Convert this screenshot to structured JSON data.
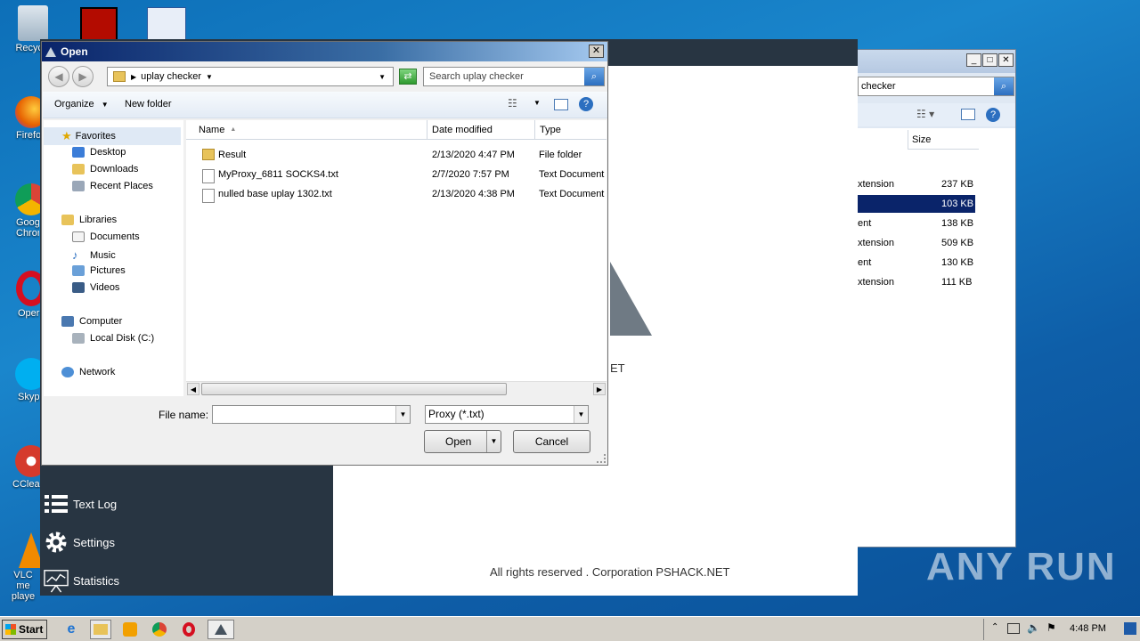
{
  "desktop": {
    "icons": [
      {
        "label": "Recycle"
      },
      {
        "label": "Firefo"
      },
      {
        "label": "Goog Chron"
      },
      {
        "label": "Oper"
      },
      {
        "label": "Skyp"
      },
      {
        "label": "CClea"
      },
      {
        "label": "VLC me playe"
      }
    ]
  },
  "app": {
    "sidebar": [
      "Text Log",
      "Settings",
      "Statistics"
    ],
    "logo_suffix": "ET",
    "footer": "All rights reserved . Corporation PSHACK.NET"
  },
  "explorer": {
    "search_text": "checker",
    "size_header": "Size",
    "rows": [
      {
        "type": "xtension",
        "size": "237 KB"
      },
      {
        "type": "",
        "size": "103 KB"
      },
      {
        "type": "ent",
        "size": "138 KB"
      },
      {
        "type": "xtension",
        "size": "509 KB"
      },
      {
        "type": "ent",
        "size": "130 KB"
      },
      {
        "type": "xtension",
        "size": "111 KB"
      }
    ]
  },
  "dialog": {
    "title": "Open",
    "address": "uplay checker",
    "search_placeholder": "Search uplay checker",
    "organize": "Organize",
    "new_folder": "New folder",
    "nav": {
      "favorites": "Favorites",
      "desktop": "Desktop",
      "downloads": "Downloads",
      "recent": "Recent Places",
      "libraries": "Libraries",
      "documents": "Documents",
      "music": "Music",
      "pictures": "Pictures",
      "videos": "Videos",
      "computer": "Computer",
      "local_disk": "Local Disk (C:)",
      "network": "Network"
    },
    "columns": {
      "name": "Name",
      "date": "Date modified",
      "type": "Type"
    },
    "files": [
      {
        "name": "Result",
        "date": "2/13/2020 4:47 PM",
        "type": "File folder"
      },
      {
        "name": "MyProxy_6811 SOCKS4.txt",
        "date": "2/7/2020 7:57 PM",
        "type": "Text Document"
      },
      {
        "name": "nulled base uplay 1302.txt",
        "date": "2/13/2020 4:38 PM",
        "type": "Text Document"
      }
    ],
    "file_name_label": "File name:",
    "file_name_value": "",
    "filter": "Proxy (*.txt)",
    "open_btn": "Open",
    "cancel_btn": "Cancel"
  },
  "taskbar": {
    "start": "Start",
    "clock": "4:48 PM"
  },
  "watermark": "ANY RUN"
}
